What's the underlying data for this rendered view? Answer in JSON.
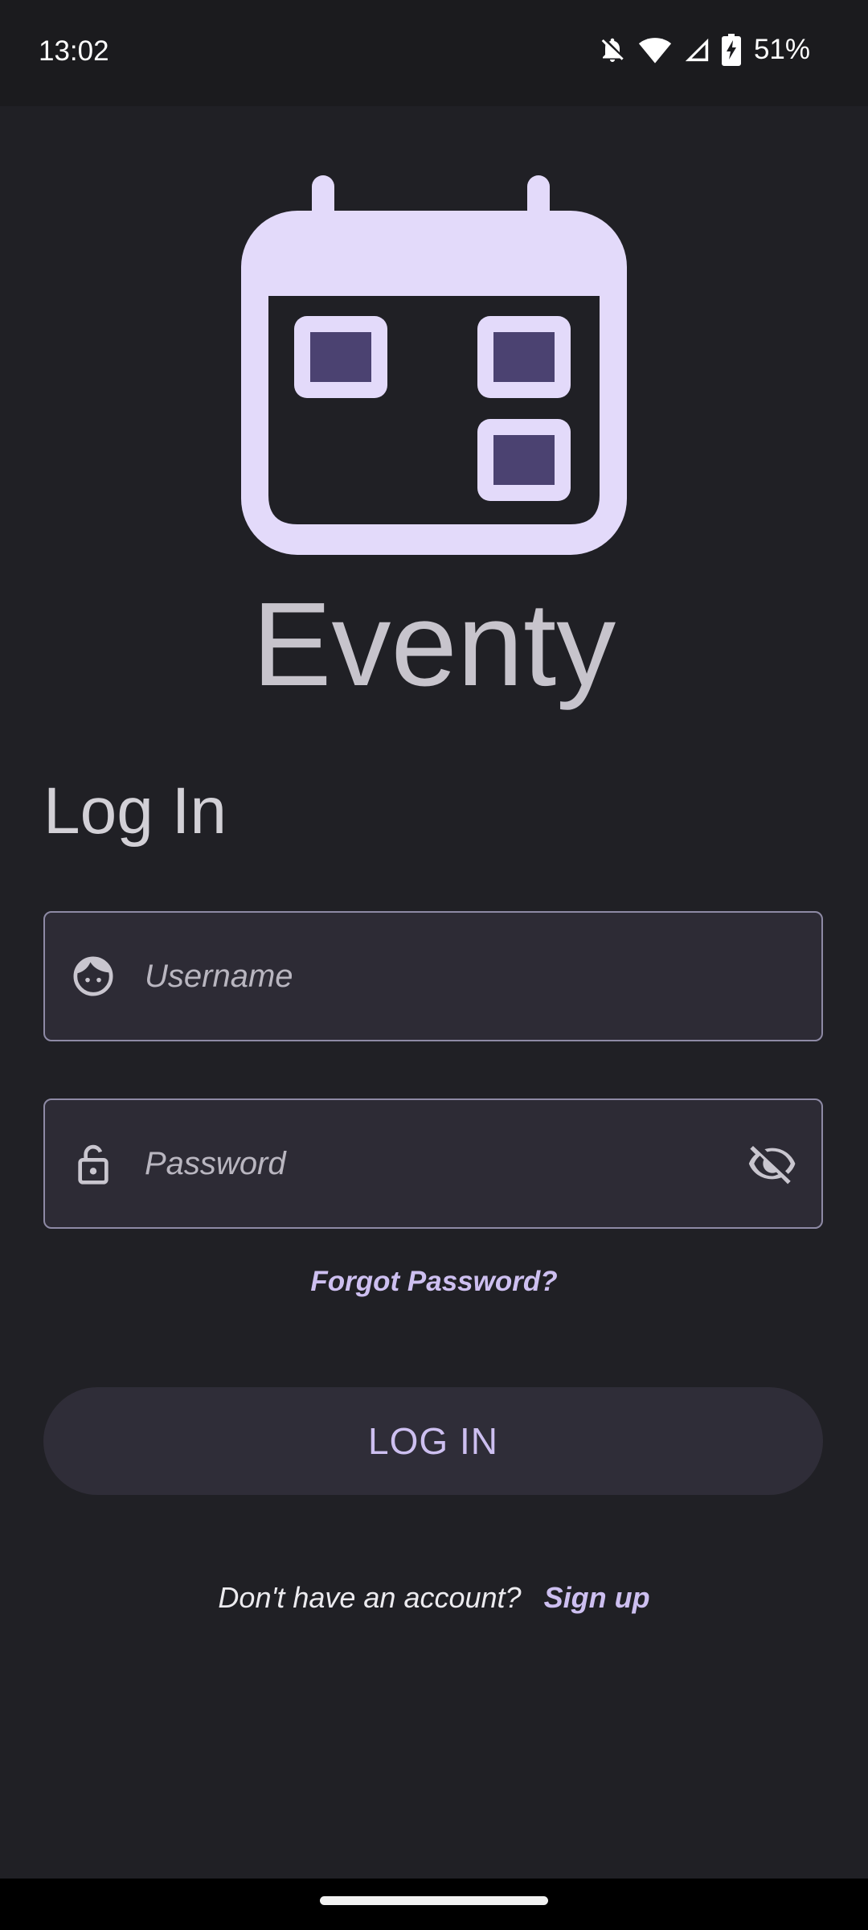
{
  "status_bar": {
    "time": "13:02",
    "battery": "51%",
    "icons": [
      "notifications-off-icon",
      "wifi-icon",
      "signal-icon",
      "battery-charging-icon"
    ]
  },
  "app": {
    "name": "Eventy",
    "logo_icon": "calendar-icon"
  },
  "login": {
    "title": "Log In",
    "username": {
      "placeholder": "Username",
      "value": "",
      "icon": "face-icon"
    },
    "password": {
      "placeholder": "Password",
      "value": "",
      "icon": "lock-icon",
      "toggle_icon": "visibility-off-icon"
    },
    "forgot_label": "Forgot Password?",
    "button_label": "LOG IN",
    "signup_prompt": "Don't have an account?",
    "signup_link": "Sign up"
  },
  "colors": {
    "background": "#202025",
    "accent": "#cdbff0",
    "logo": "#e3dafa",
    "logo_cells": "#4b4271"
  }
}
